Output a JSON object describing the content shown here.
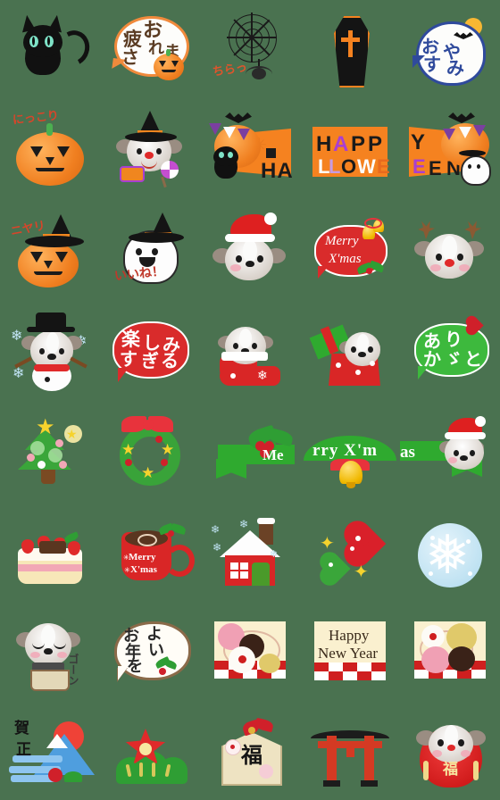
{
  "sheet": {
    "title": "Emoji sticker sheet",
    "background_color": "#4a7250",
    "columns": 5,
    "rows": 8,
    "cell_size_px": 112,
    "theme": "Halloween / Christmas / Japanese New Year shih-tzu dog emoji"
  },
  "cells": [
    {
      "id": "r1c1",
      "name": "black-cat",
      "type": "illustration",
      "text": "",
      "colors": [
        "#111111",
        "#7fe3c8"
      ]
    },
    {
      "id": "r1c2",
      "name": "otsukaresama-bubble-pumpkin",
      "type": "speech-bubble",
      "text": "お疲れさま",
      "colors": [
        "#fdfdfb",
        "#f08a3c"
      ]
    },
    {
      "id": "r1c3",
      "name": "spider-web-chirari",
      "type": "illustration",
      "text": "ちらっ",
      "colors": [
        "#1a1a1a",
        "#e0542b"
      ]
    },
    {
      "id": "r1c4",
      "name": "coffin-cross",
      "type": "illustration",
      "text": "",
      "colors": [
        "#141414",
        "#f58220"
      ]
    },
    {
      "id": "r1c5",
      "name": "oyasumi-ghost-bubble",
      "type": "speech-bubble",
      "text": "おやすみ",
      "colors": [
        "#fdfdfd",
        "#2f4a9c",
        "#f7b733"
      ]
    },
    {
      "id": "r2c1",
      "name": "nikkori-pumpkin",
      "type": "illustration",
      "text": "にっこり",
      "colors": [
        "#f07f20",
        "#1b1b1b"
      ]
    },
    {
      "id": "r2c2",
      "name": "dog-witch-candy",
      "type": "illustration",
      "text": "",
      "colors": [
        "#141414",
        "#c44ed0",
        "#f0861f"
      ]
    },
    {
      "id": "r2c3",
      "name": "halloween-banner-part1",
      "type": "banner",
      "text": "HA",
      "colors": [
        "#f58220",
        "#141414"
      ]
    },
    {
      "id": "r2c4",
      "name": "halloween-banner-part2",
      "type": "banner",
      "text": "HAPPY LLOWE",
      "colors": [
        "#f58220",
        "#141414",
        "#a93fd1",
        "#ffffff"
      ]
    },
    {
      "id": "r2c5",
      "name": "halloween-banner-part3",
      "type": "banner",
      "text": "Y EEN",
      "colors": [
        "#f58220",
        "#141414"
      ]
    },
    {
      "id": "r3c1",
      "name": "niyari-witch-pumpkin",
      "type": "illustration",
      "text": "ニヤリ",
      "colors": [
        "#f07f20",
        "#141414"
      ]
    },
    {
      "id": "r3c2",
      "name": "iine-ghost-witch",
      "type": "illustration",
      "text": "いいね！",
      "colors": [
        "#fdfdfd",
        "#141414"
      ]
    },
    {
      "id": "r3c3",
      "name": "dog-santa-hat",
      "type": "illustration",
      "text": "",
      "colors": [
        "#de2020",
        "#d9d2cb"
      ]
    },
    {
      "id": "r3c4",
      "name": "merry-xmas-red-bubble",
      "type": "speech-bubble",
      "text": "Merry X'mas",
      "colors": [
        "#d92b2b",
        "#ffffff"
      ]
    },
    {
      "id": "r3c5",
      "name": "dog-reindeer",
      "type": "illustration",
      "text": "",
      "colors": [
        "#8a5a33",
        "#d9d2cb"
      ]
    },
    {
      "id": "r4c1",
      "name": "dog-snowman",
      "type": "illustration",
      "text": "",
      "colors": [
        "#ffffff",
        "#141414",
        "#bfe2f2"
      ]
    },
    {
      "id": "r4c2",
      "name": "tanoshimi-sugiru-bubble",
      "type": "speech-bubble",
      "text": "楽しみすぎる",
      "colors": [
        "#d92b2b",
        "#ffffff"
      ]
    },
    {
      "id": "r4c3",
      "name": "dog-in-stocking",
      "type": "illustration",
      "text": "",
      "colors": [
        "#d92626",
        "#ffffff"
      ]
    },
    {
      "id": "r4c4",
      "name": "dog-in-gift-box",
      "type": "illustration",
      "text": "",
      "colors": [
        "#d92626",
        "#2faa2f"
      ]
    },
    {
      "id": "r4c5",
      "name": "arigato-green-bubble",
      "type": "speech-bubble",
      "text": "ありがとう",
      "colors": [
        "#3db93d",
        "#ffffff",
        "#d0202a"
      ]
    },
    {
      "id": "r5c1",
      "name": "christmas-tree",
      "type": "illustration",
      "text": "",
      "colors": [
        "#3aa63a",
        "#f6d32d"
      ]
    },
    {
      "id": "r5c2",
      "name": "christmas-wreath",
      "type": "illustration",
      "text": "",
      "colors": [
        "#39a339",
        "#e8333c",
        "#f6d32d"
      ]
    },
    {
      "id": "r5c3",
      "name": "xmas-banner-part1",
      "type": "banner",
      "text": "Me",
      "colors": [
        "#2faa2f",
        "#ffffff",
        "#d0202a"
      ]
    },
    {
      "id": "r5c4",
      "name": "xmas-banner-part2",
      "type": "banner",
      "text": "rry X'm",
      "colors": [
        "#2faa2f",
        "#ffffff",
        "#f0b800"
      ]
    },
    {
      "id": "r5c5",
      "name": "xmas-banner-part3",
      "type": "banner",
      "text": "as",
      "colors": [
        "#2faa2f",
        "#ffffff",
        "#de2020"
      ]
    },
    {
      "id": "r6c1",
      "name": "christmas-cake",
      "type": "illustration",
      "text": "",
      "colors": [
        "#fffaf0",
        "#e02a2a"
      ]
    },
    {
      "id": "r6c2",
      "name": "merry-xmas-mug",
      "type": "illustration",
      "text": "Merry X'mas",
      "colors": [
        "#d92626",
        "#5a3620"
      ]
    },
    {
      "id": "r6c3",
      "name": "snowy-house",
      "type": "illustration",
      "text": "",
      "colors": [
        "#d92626",
        "#fdfdfd"
      ]
    },
    {
      "id": "r6c4",
      "name": "red-green-hearts",
      "type": "illustration",
      "text": "",
      "colors": [
        "#d9202a",
        "#3aa63a",
        "#f6d32d"
      ]
    },
    {
      "id": "r6c5",
      "name": "snowflake-ball",
      "type": "illustration",
      "text": "",
      "colors": [
        "#bfe2f2",
        "#ffffff"
      ]
    },
    {
      "id": "r7c1",
      "name": "dog-ringing-bell-goon",
      "type": "illustration",
      "text": "ゴーン",
      "colors": [
        "#d9d2cb",
        "#3a3a3a"
      ]
    },
    {
      "id": "r7c2",
      "name": "yoi-otoshi-wo-bubble",
      "type": "speech-bubble",
      "text": "よいお年を",
      "colors": [
        "#fffdf7",
        "#8a6a49"
      ]
    },
    {
      "id": "r7c3",
      "name": "new-year-plum-blossoms-left",
      "type": "illustration",
      "text": "",
      "colors": [
        "#faf0cf",
        "#cf1f1f",
        "#ec5a84"
      ]
    },
    {
      "id": "r7c4",
      "name": "happy-new-year-card",
      "type": "card",
      "text": "Happy New Year",
      "colors": [
        "#faf0cf",
        "#cf1f1f",
        "#3a2a1a"
      ]
    },
    {
      "id": "r7c5",
      "name": "new-year-plum-blossoms-right",
      "type": "illustration",
      "text": "",
      "colors": [
        "#faf0cf",
        "#cf1f1f",
        "#e0c96a"
      ]
    },
    {
      "id": "r8c1",
      "name": "gashou-mount-fuji",
      "type": "illustration",
      "text": "賀正",
      "colors": [
        "#4f9ede",
        "#ef4237",
        "#141414"
      ]
    },
    {
      "id": "r8c2",
      "name": "kadomatsu-plum",
      "type": "illustration",
      "text": "",
      "colors": [
        "#e02a2a",
        "#2f9e34"
      ]
    },
    {
      "id": "r8c3",
      "name": "ema-fuku-plaque",
      "type": "illustration",
      "text": "福",
      "colors": [
        "#eee3c2",
        "#141414",
        "#cf1f1f"
      ]
    },
    {
      "id": "r8c4",
      "name": "torii-gate",
      "type": "illustration",
      "text": "",
      "colors": [
        "#d43a23",
        "#1c1c1c"
      ]
    },
    {
      "id": "r8c5",
      "name": "dog-daruma-fuku",
      "type": "illustration",
      "text": "福",
      "colors": [
        "#cf1a1a",
        "#d9d2cb"
      ]
    }
  ]
}
